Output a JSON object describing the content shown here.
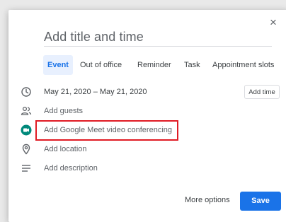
{
  "dialog": {
    "title_placeholder": "Add title and time",
    "close_glyph": "×",
    "tabs": [
      {
        "label": "Event",
        "active": true
      },
      {
        "label": "Out of office",
        "active": false
      },
      {
        "label": "Reminder",
        "active": false
      },
      {
        "label": "Task",
        "active": false
      },
      {
        "label": "Appointment slots",
        "active": false
      }
    ],
    "rows": [
      {
        "icon": "clock-icon",
        "label": "May 21, 2020  –  May 21, 2020"
      },
      {
        "icon": "people-icon",
        "label": "Add guests"
      },
      {
        "icon": "google-meet-icon",
        "label": "Add Google Meet video conferencing"
      },
      {
        "icon": "location-pin-icon",
        "label": "Add location"
      },
      {
        "icon": "description-lines-icon",
        "label": "Add description"
      }
    ],
    "add_time_label": "Add time",
    "more_options_label": "More options",
    "save_label": "Save"
  },
  "colors": {
    "accent": "#1a73e8",
    "highlight_box": "#e01b24",
    "meet_icon": "#00897b"
  }
}
